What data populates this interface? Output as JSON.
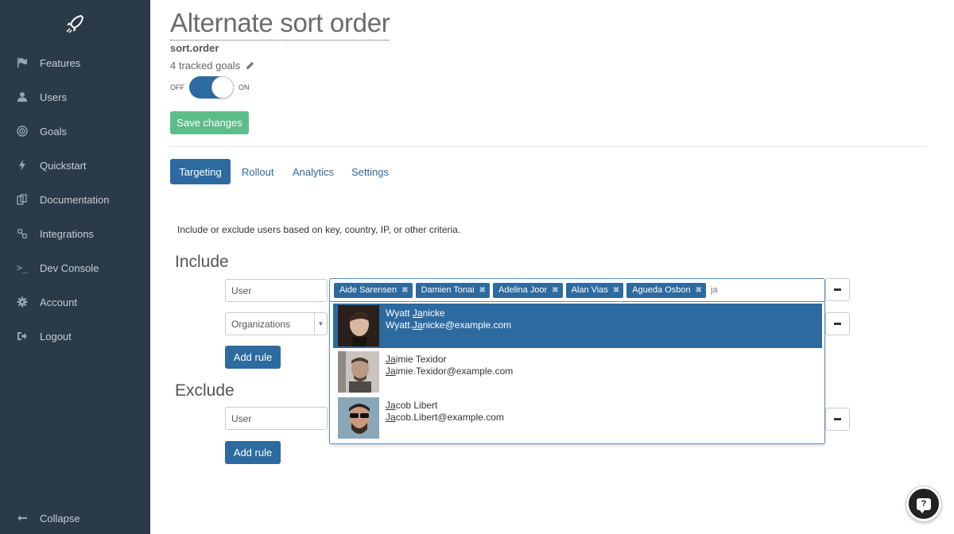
{
  "sidebar": {
    "items": [
      {
        "label": "Features",
        "icon": "flag-icon"
      },
      {
        "label": "Users",
        "icon": "user-icon"
      },
      {
        "label": "Goals",
        "icon": "target-icon"
      },
      {
        "label": "Quickstart",
        "icon": "bolt-icon"
      },
      {
        "label": "Documentation",
        "icon": "docs-icon"
      },
      {
        "label": "Integrations",
        "icon": "integrations-icon"
      },
      {
        "label": "Dev Console",
        "icon": "terminal-icon"
      },
      {
        "label": "Account",
        "icon": "gear-icon"
      },
      {
        "label": "Logout",
        "icon": "logout-icon"
      }
    ],
    "collapse_label": "Collapse"
  },
  "header": {
    "title": "Alternate sort order",
    "flag_key": "sort.order",
    "tracked_goals": "4 tracked goals",
    "toggle_off": "OFF",
    "toggle_on": "ON",
    "toggle_state": "on",
    "save_label": "Save changes"
  },
  "tabs": [
    "Targeting",
    "Rollout",
    "Analytics",
    "Settings"
  ],
  "active_tab": "Targeting",
  "targeting": {
    "description": "Include or exclude users based on key, country, IP, or other criteria.",
    "include_title": "Include",
    "exclude_title": "Exclude",
    "include_rules": [
      {
        "attribute": "User"
      },
      {
        "attribute": "Organizations"
      }
    ],
    "exclude_rules": [
      {
        "attribute": "User"
      }
    ],
    "add_rule_label": "Add rule",
    "selected_tags": [
      "Aide Sarensen",
      "Damien Tonai",
      "Adelina Joor",
      "Alan Vias",
      "Agueda Osbon"
    ],
    "tag_remove_glyph": "✖",
    "search_text": "ja",
    "suggestions": [
      {
        "name_pre": "Wyatt ",
        "name_match": "Ja",
        "name_post": "nicke",
        "email_pre": "Wyatt.",
        "email_match": "Ja",
        "email_post": "nicke@example.com"
      },
      {
        "name_pre": "",
        "name_match": "Ja",
        "name_post": "imie Texidor",
        "email_pre": "",
        "email_match": "Ja",
        "email_post": "imie.Texidor@example.com"
      },
      {
        "name_pre": "",
        "name_match": "Ja",
        "name_post": "cob Libert",
        "email_pre": "",
        "email_match": "Ja",
        "email_post": "cob.Libert@example.com"
      }
    ]
  },
  "help": {
    "glyph": "?"
  },
  "colors": {
    "sidebar_bg": "#2b3a48",
    "primary": "#2d6a9f",
    "save_green": "#5dbd88"
  }
}
